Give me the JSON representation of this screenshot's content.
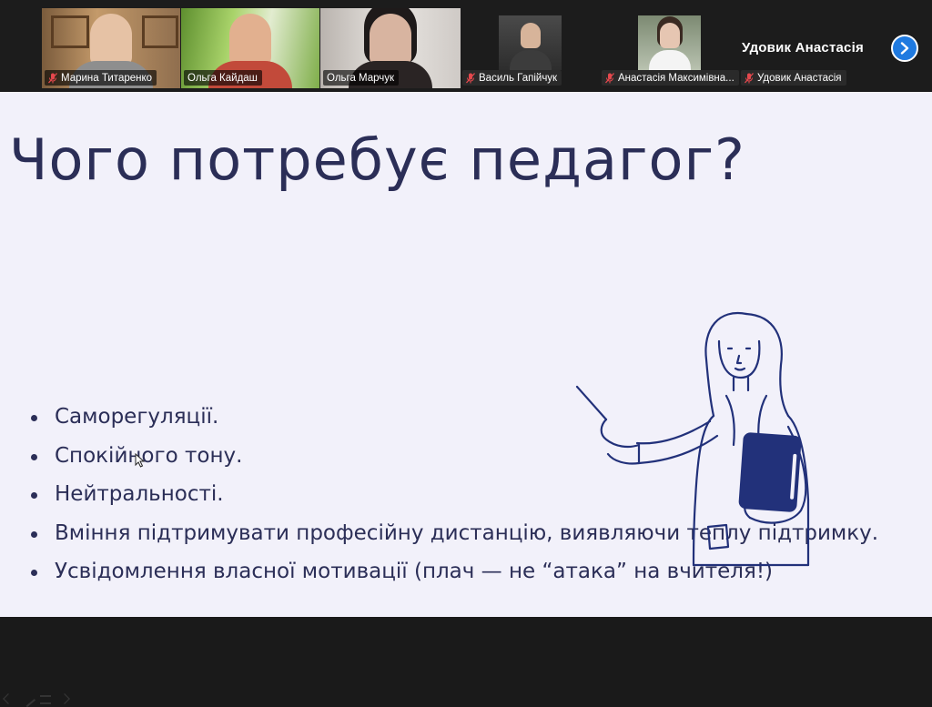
{
  "participants": [
    {
      "name": "Марина Титаренко",
      "muted": true
    },
    {
      "name": "Ольга Кайдаш",
      "muted": false
    },
    {
      "name": "Ольга Марчук",
      "muted": false,
      "active": true
    },
    {
      "name": "Василь Гапійчук",
      "muted": true
    },
    {
      "name": "Анастасія Максимівна...",
      "muted": true
    },
    {
      "name": "Удовик Анастасія",
      "muted": true
    }
  ],
  "current_speaker": "Удовик  Анастасія",
  "slide": {
    "title": "Чого потребує педагог?",
    "bullets": [
      "Саморегуляції.",
      "Спокійного тону.",
      "Нейтральності.",
      "Вміння підтримувати професійну дистанцію, виявляючи теплу підтримку.",
      "Усвідомлення власної мотивації (плач — не “атака” на вчителя!)"
    ]
  },
  "icons": {
    "mic_off": "mic-off-icon",
    "next": "chevron-right-icon",
    "cursor": "mouse-pointer-icon"
  },
  "colors": {
    "slide_bg": "#f2f1fa",
    "slide_text": "#2b2e57",
    "illustration": "#22317a",
    "active_tile": "#2ecf6e",
    "next_button": "#1f7ae0",
    "mic_off": "#e5484d"
  }
}
